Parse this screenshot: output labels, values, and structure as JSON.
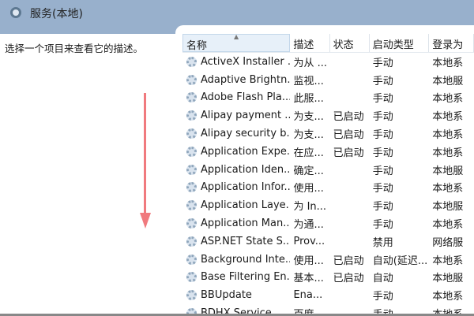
{
  "window": {
    "title": "服务(本地)"
  },
  "left": {
    "description": "选择一个项目来查看它的描述。"
  },
  "columns": [
    "名称",
    "描述",
    "状态",
    "启动类型",
    "登录为"
  ],
  "rows": [
    {
      "name": "ActiveX Installer ...",
      "desc": "为从 ...",
      "status": "",
      "startup": "手动",
      "logon": "本地系"
    },
    {
      "name": "Adaptive Brightn...",
      "desc": "监视...",
      "status": "",
      "startup": "手动",
      "logon": "本地服"
    },
    {
      "name": "Adobe Flash Pla...",
      "desc": "此服...",
      "status": "",
      "startup": "手动",
      "logon": "本地系"
    },
    {
      "name": "Alipay payment ...",
      "desc": "为支...",
      "status": "已启动",
      "startup": "手动",
      "logon": "本地系"
    },
    {
      "name": "Alipay security b...",
      "desc": "为支...",
      "status": "已启动",
      "startup": "手动",
      "logon": "本地系"
    },
    {
      "name": "Application Expe...",
      "desc": "在应...",
      "status": "已启动",
      "startup": "手动",
      "logon": "本地系"
    },
    {
      "name": "Application Iden...",
      "desc": "确定...",
      "status": "",
      "startup": "手动",
      "logon": "本地服"
    },
    {
      "name": "Application Infor...",
      "desc": "使用...",
      "status": "",
      "startup": "手动",
      "logon": "本地系"
    },
    {
      "name": "Application Laye...",
      "desc": "为 In...",
      "status": "",
      "startup": "手动",
      "logon": "本地服"
    },
    {
      "name": "Application Man...",
      "desc": "为通...",
      "status": "",
      "startup": "手动",
      "logon": "本地系"
    },
    {
      "name": "ASP.NET State S...",
      "desc": "Prov...",
      "status": "",
      "startup": "禁用",
      "logon": "网络服"
    },
    {
      "name": "Background Inte...",
      "desc": "使用...",
      "status": "已启动",
      "startup": "自动(延迟...",
      "logon": "本地系"
    },
    {
      "name": "Base Filtering En...",
      "desc": "基本...",
      "status": "已启动",
      "startup": "自动",
      "logon": "本地服"
    },
    {
      "name": "BBUpdate",
      "desc": "Ena...",
      "status": "",
      "startup": "手动",
      "logon": "本地系"
    },
    {
      "name": "BDHX Service",
      "desc": "百度...",
      "status": "",
      "startup": "手动",
      "logon": "本地系"
    }
  ]
}
